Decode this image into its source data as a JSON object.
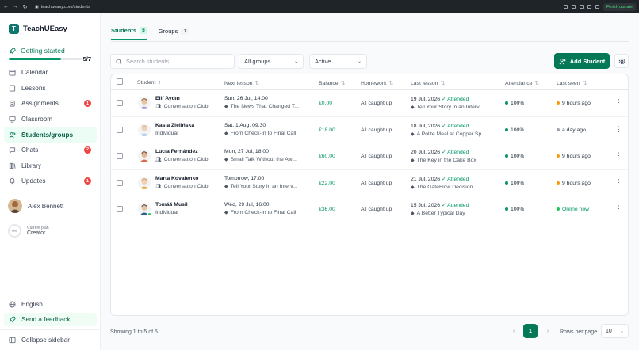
{
  "browser": {
    "url": "teachueasy.com/students",
    "finish_label": "Finish update"
  },
  "app": {
    "name": "TeachUEasy",
    "logo_letter": "T",
    "brand_color": "#047857"
  },
  "getting_started": {
    "label": "Getting started",
    "progress": "5/7",
    "progress_fraction": 0.714
  },
  "sidebar": {
    "items": [
      {
        "label": "Calendar",
        "icon": "calendar-icon"
      },
      {
        "label": "Lessons",
        "icon": "book-icon"
      },
      {
        "label": "Assignments",
        "icon": "clipboard-icon",
        "badge": "1"
      },
      {
        "label": "Classroom",
        "icon": "monitor-icon"
      },
      {
        "label": "Students/groups",
        "icon": "users-icon",
        "active": true
      },
      {
        "label": "Chats",
        "icon": "chat-icon",
        "badge": "2"
      },
      {
        "label": "Library",
        "icon": "library-icon"
      },
      {
        "label": "Updates",
        "icon": "bell-icon",
        "badge": "1"
      }
    ],
    "user_name": "Alex Bennett",
    "plan_percent": "0%",
    "plan_label": "Current plan",
    "plan_name": "Creator",
    "language": "English",
    "feedback": "Send a feedback",
    "collapse": "Collapse sidebar"
  },
  "tabs": [
    {
      "label": "Students",
      "count": "5",
      "active": true
    },
    {
      "label": "Groups",
      "count": "1"
    }
  ],
  "filters": {
    "search_placeholder": "Search students...",
    "group": "All groups",
    "status": "Active",
    "add_label": "Add Student"
  },
  "table": {
    "headers": {
      "student": "Student",
      "next": "Next lesson",
      "balance": "Balance",
      "homework": "Homework",
      "last": "Last lesson",
      "attendance": "Attendance",
      "seen": "Last seen"
    },
    "rows": [
      {
        "name": "Elif Aydın",
        "type": "Conversation Club",
        "next_date": "Sun, 26 Jul, 14:00",
        "next_title": "The News That Changed T...",
        "balance": "€0.00",
        "homework": "All caught up",
        "last_date": "19 Jul, 2026",
        "last_status": "Attended",
        "last_title": "Tell Your Story in an Interv...",
        "attendance": "100%",
        "seen": "9 hours ago",
        "seen_color": "#f59e0b"
      },
      {
        "name": "Kasia Zielińska",
        "type": "Individual",
        "next_date": "Sat, 1 Aug, 09:30",
        "next_title": "From Check-In to Final Call",
        "balance": "€18.00",
        "homework": "All caught up",
        "last_date": "18 Jul, 2026",
        "last_status": "Attended",
        "last_title": "A Polite Meal at Copper Sp...",
        "attendance": "100%",
        "seen": "a day ago",
        "seen_color": "#9ca3af"
      },
      {
        "name": "Lucía Fernández",
        "type": "Conversation Club",
        "next_date": "Mon, 27 Jul, 18:00",
        "next_title": "Small Talk Without the Aw...",
        "balance": "€60.00",
        "homework": "All caught up",
        "last_date": "20 Jul, 2026",
        "last_status": "Attended",
        "last_title": "The Key in the Cake Box",
        "attendance": "100%",
        "seen": "9 hours ago",
        "seen_color": "#f59e0b"
      },
      {
        "name": "Marta Kovalenko",
        "type": "Conversation Club",
        "next_date": "Tomorrow, 17:00",
        "next_title": "Tell Your Story in an Interv...",
        "balance": "€22.00",
        "homework": "All caught up",
        "last_date": "21 Jul, 2026",
        "last_status": "Attended",
        "last_title": "The GateFlow Decision",
        "attendance": "100%",
        "seen": "9 hours ago",
        "seen_color": "#f59e0b"
      },
      {
        "name": "Tomáš Musil",
        "type": "Individual",
        "next_date": "Wed, 29 Jul, 16:00",
        "next_title": "From Check-In to Final Call",
        "balance": "€36.00",
        "homework": "All caught up",
        "last_date": "15 Jul, 2026",
        "last_status": "Attended",
        "last_title": "A Better Typical Day",
        "attendance": "100%",
        "seen": "Online now",
        "seen_color": "#22c55e"
      }
    ]
  },
  "footer": {
    "showing": "Showing 1 to 5 of 5",
    "page": "1",
    "rows_label": "Rows per page",
    "rows_value": "10"
  }
}
